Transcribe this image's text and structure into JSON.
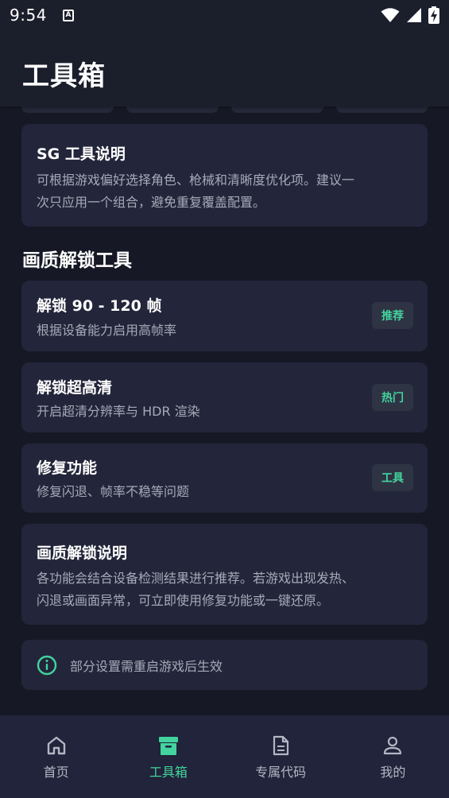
{
  "status_bar": {
    "time": "9:54",
    "notification_letter": "A"
  },
  "header": {
    "title": "工具箱"
  },
  "sg_info_card": {
    "title": "SG 工具说明",
    "desc_line1": "可根据游戏偏好选择角色、枪械和清晰度优化项。建议一",
    "desc_line2": "次只应用一个组合，避免重复覆盖配置。"
  },
  "section": {
    "title": "画质解锁工具"
  },
  "tools": [
    {
      "title": "解锁 90 - 120 帧",
      "desc": "根据设备能力启用高帧率",
      "badge": "推荐"
    },
    {
      "title": "解锁超高清",
      "desc": "开启超清分辨率与 HDR 渲染",
      "badge": "热门"
    },
    {
      "title": "修复功能",
      "desc": "修复闪退、帧率不稳等问题",
      "badge": "工具"
    }
  ],
  "quality_info_card": {
    "title": "画质解锁说明",
    "desc_line1": "各功能会结合设备检测结果进行推荐。若游戏出现发热、",
    "desc_line2": "闪退或画面异常，可立即使用修复功能或一键还原。"
  },
  "notice": {
    "text": "部分设置需重启游戏后生效",
    "icon": "info-icon"
  },
  "nav": {
    "items": [
      {
        "label": "首页",
        "icon": "home-icon"
      },
      {
        "label": "工具箱",
        "icon": "archive-icon"
      },
      {
        "label": "专属代码",
        "icon": "document-icon"
      },
      {
        "label": "我的",
        "icon": "user-icon"
      }
    ],
    "active_index": 1
  },
  "colors": {
    "background": "#161925",
    "header": "#1b1e2b",
    "card": "#23263a",
    "accent": "#43d39e",
    "muted_text": "#a6a9b8"
  }
}
